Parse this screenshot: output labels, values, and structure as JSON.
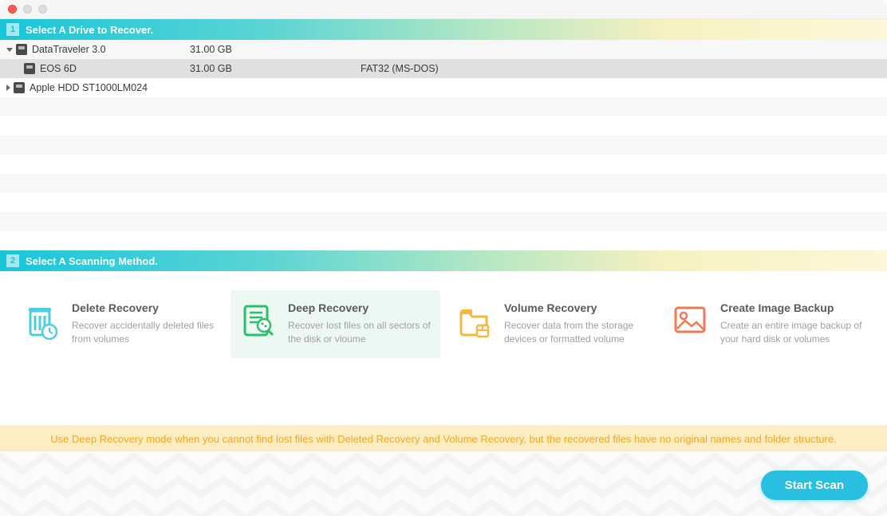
{
  "step1": {
    "num": "1",
    "title": "Select A Drive to Recover."
  },
  "step2": {
    "num": "2",
    "title": "Select A Scanning Method."
  },
  "drives": [
    {
      "name": "DataTraveler 3.0",
      "size": "31.00 GB",
      "format": ""
    },
    {
      "name": "EOS 6D",
      "size": "31.00 GB",
      "format": "FAT32 (MS-DOS)"
    },
    {
      "name": "Apple HDD ST1000LM024",
      "size": "",
      "format": ""
    }
  ],
  "methods": [
    {
      "title": "Delete Recovery",
      "desc": "Recover accidentally deleted files from volumes"
    },
    {
      "title": "Deep Recovery",
      "desc": "Recover lost files on all sectors of the disk or vloume"
    },
    {
      "title": "Volume Recovery",
      "desc": "Recover data from the storage devices or formatted volume"
    },
    {
      "title": "Create Image Backup",
      "desc": "Create an entire image backup of your hard disk or volumes"
    }
  ],
  "hint": "Use Deep Recovery mode when you cannot find lost files with Deleted Recovery and Volume Recovery, but the recovered files have no original names and folder structure.",
  "start_scan": "Start Scan"
}
